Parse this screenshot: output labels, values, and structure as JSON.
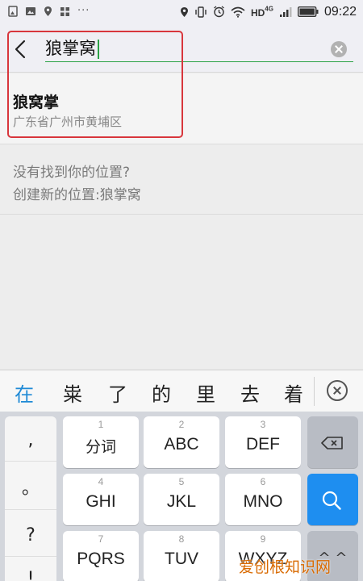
{
  "status_bar": {
    "left_icons": [
      "image-icon",
      "image-icon",
      "location-icon",
      "grid-icon"
    ],
    "more": "···",
    "right_icons": [
      "location-icon",
      "vibrate-icon",
      "alarm-icon",
      "wifi-icon",
      "hd-4g-label",
      "signal-icon",
      "battery-icon"
    ],
    "network": "HD",
    "network_super": "4G",
    "time": "09:22"
  },
  "search": {
    "query": "狼掌窝"
  },
  "results": [
    {
      "title": "狼窝掌",
      "subtitle": "广东省广州市黄埔区"
    }
  ],
  "create_new": {
    "line1": "没有找到你的位置?",
    "line2": "创建新的位置:狼掌窝"
  },
  "candidates": [
    "在",
    "粜",
    "了",
    "的",
    "里",
    "去",
    "着"
  ],
  "keyboard": {
    "punctuation": [
      ",",
      "。",
      "?",
      "!"
    ],
    "keys": [
      {
        "num": "1",
        "label": "分词"
      },
      {
        "num": "2",
        "label": "ABC"
      },
      {
        "num": "3",
        "label": "DEF"
      },
      {
        "num": "4",
        "label": "GHI"
      },
      {
        "num": "5",
        "label": "JKL"
      },
      {
        "num": "6",
        "label": "MNO"
      },
      {
        "num": "7",
        "label": "PQRS"
      },
      {
        "num": "8",
        "label": "TUV"
      },
      {
        "num": "9",
        "label": "WXYZ"
      }
    ],
    "delete_icon": "backspace-icon",
    "search_icon": "search-icon",
    "shift_label": "^ ^"
  },
  "watermark": "爱创根知识网",
  "colors": {
    "accent_green": "#2ba245",
    "highlight_red": "#d8363c",
    "candidate_active": "#1f8ad6",
    "search_key_blue": "#1e8ef0"
  }
}
